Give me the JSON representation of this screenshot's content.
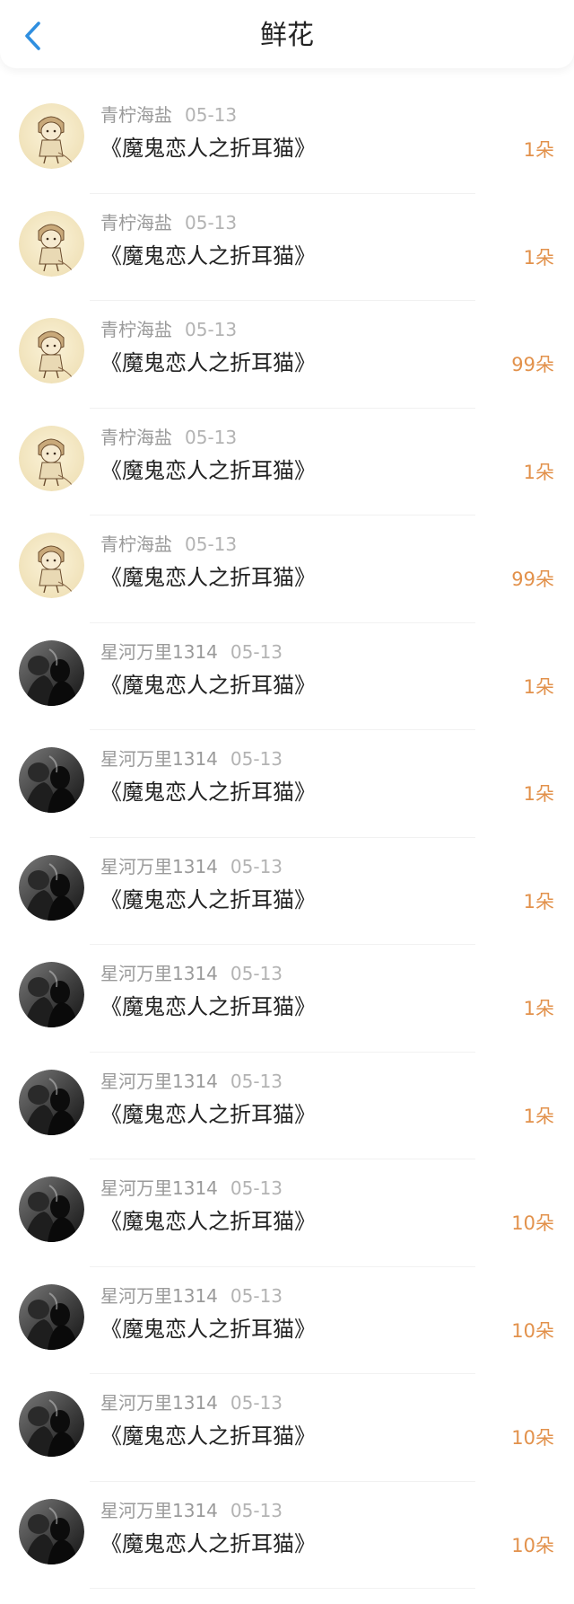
{
  "header": {
    "title": "鲜花",
    "back_icon": "chevron-left-icon"
  },
  "colors": {
    "accent_blue": "#2f8fe0",
    "count_orange": "#e2914b",
    "meta_gray": "#9a9a9a",
    "divider": "#f1f1f1"
  },
  "items": [
    {
      "user": "青柠海盐",
      "date": "05-13",
      "title": "《魔鬼恋人之折耳猫》",
      "count": "1朵",
      "avatar": "anime-boy-avatar"
    },
    {
      "user": "青柠海盐",
      "date": "05-13",
      "title": "《魔鬼恋人之折耳猫》",
      "count": "1朵",
      "avatar": "anime-boy-avatar"
    },
    {
      "user": "青柠海盐",
      "date": "05-13",
      "title": "《魔鬼恋人之折耳猫》",
      "count": "99朵",
      "avatar": "anime-boy-avatar"
    },
    {
      "user": "青柠海盐",
      "date": "05-13",
      "title": "《魔鬼恋人之折耳猫》",
      "count": "1朵",
      "avatar": "anime-boy-avatar"
    },
    {
      "user": "青柠海盐",
      "date": "05-13",
      "title": "《魔鬼恋人之折耳猫》",
      "count": "99朵",
      "avatar": "anime-boy-avatar"
    },
    {
      "user": "星河万里1314",
      "date": "05-13",
      "title": "《魔鬼恋人之折耳猫》",
      "count": "1朵",
      "avatar": "silhouette-couple-avatar"
    },
    {
      "user": "星河万里1314",
      "date": "05-13",
      "title": "《魔鬼恋人之折耳猫》",
      "count": "1朵",
      "avatar": "silhouette-couple-avatar"
    },
    {
      "user": "星河万里1314",
      "date": "05-13",
      "title": "《魔鬼恋人之折耳猫》",
      "count": "1朵",
      "avatar": "silhouette-couple-avatar"
    },
    {
      "user": "星河万里1314",
      "date": "05-13",
      "title": "《魔鬼恋人之折耳猫》",
      "count": "1朵",
      "avatar": "silhouette-couple-avatar"
    },
    {
      "user": "星河万里1314",
      "date": "05-13",
      "title": "《魔鬼恋人之折耳猫》",
      "count": "1朵",
      "avatar": "silhouette-couple-avatar"
    },
    {
      "user": "星河万里1314",
      "date": "05-13",
      "title": "《魔鬼恋人之折耳猫》",
      "count": "10朵",
      "avatar": "silhouette-couple-avatar"
    },
    {
      "user": "星河万里1314",
      "date": "05-13",
      "title": "《魔鬼恋人之折耳猫》",
      "count": "10朵",
      "avatar": "silhouette-couple-avatar"
    },
    {
      "user": "星河万里1314",
      "date": "05-13",
      "title": "《魔鬼恋人之折耳猫》",
      "count": "10朵",
      "avatar": "silhouette-couple-avatar"
    },
    {
      "user": "星河万里1314",
      "date": "05-13",
      "title": "《魔鬼恋人之折耳猫》",
      "count": "10朵",
      "avatar": "silhouette-couple-avatar"
    }
  ]
}
